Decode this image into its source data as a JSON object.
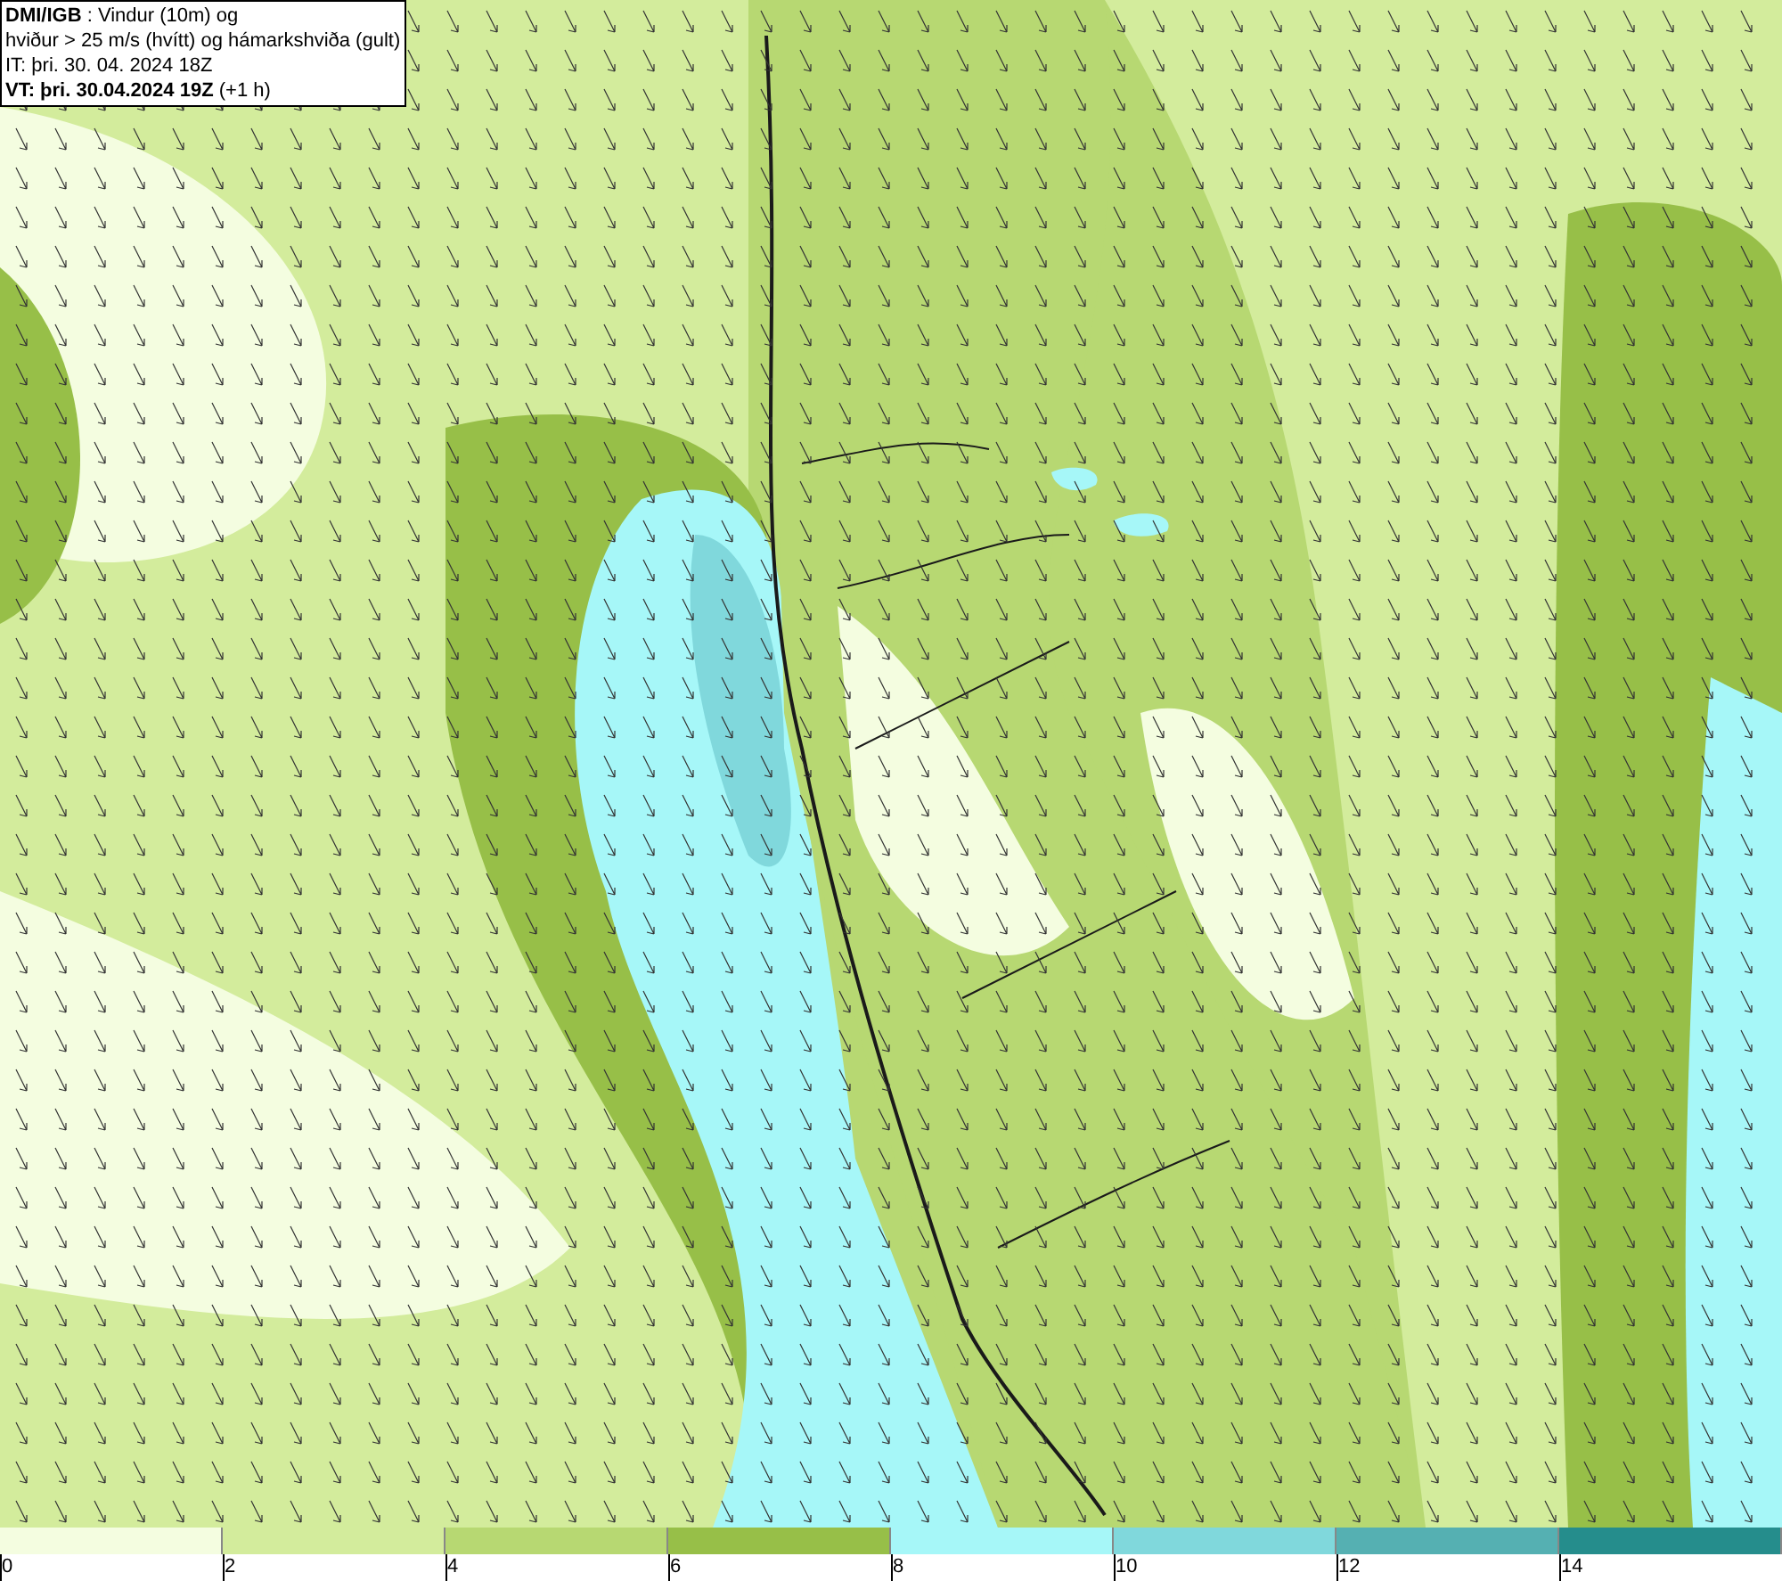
{
  "header": {
    "lines": [
      "**DMI/IGB** : Vindur (10m) og",
      "hviður > 25 m/s (hvítt) og hámarkshviða (gult)",
      "IT: þri. 30. 04. 2024 18Z",
      "**VT: þri. 30.04.2024 19Z** (+1 h)"
    ]
  },
  "legend": {
    "bins": [
      {
        "color": "#f4fde0"
      },
      {
        "color": "#d3ec9c"
      },
      {
        "color": "#b7d872"
      },
      {
        "color": "#97bf48"
      },
      {
        "color": "#a6f7f8"
      },
      {
        "color": "#80d8dc"
      },
      {
        "color": "#55b0b2"
      },
      {
        "color": "#258d8c"
      }
    ],
    "ticks": [
      "0",
      "2",
      "4",
      "6",
      "8",
      "10",
      "12",
      "14"
    ]
  }
}
